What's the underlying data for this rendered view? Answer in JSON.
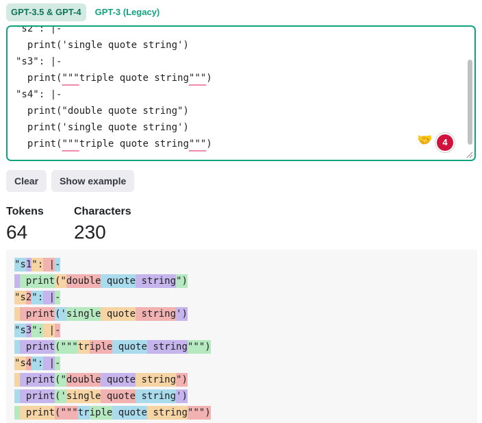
{
  "tabs": [
    {
      "label": "GPT-3.5 & GPT-4",
      "active": true
    },
    {
      "label": "GPT-3 (Legacy)",
      "active": false
    }
  ],
  "editor": {
    "lines": [
      [
        {
          "t": "\"s2\": |-",
          "sq": false
        }
      ],
      [
        {
          "t": "  print('single quote string')",
          "sq": false
        }
      ],
      [
        {
          "t": "\"s3\": |-",
          "sq": false
        }
      ],
      [
        {
          "t": "  print(",
          "sq": false
        },
        {
          "t": "\"\"\"",
          "sq": true
        },
        {
          "t": "triple quote string",
          "sq": false
        },
        {
          "t": "\"\"\"",
          "sq": true
        },
        {
          "t": ")",
          "sq": false
        }
      ],
      [
        {
          "t": "\"s4\": |-",
          "sq": false
        }
      ],
      [
        {
          "t": "  print(\"double quote string\")",
          "sq": false
        }
      ],
      [
        {
          "t": "  print('single quote string')",
          "sq": false
        }
      ],
      [
        {
          "t": "  print(",
          "sq": false
        },
        {
          "t": "\"\"\"",
          "sq": true
        },
        {
          "t": "triple quote string",
          "sq": false
        },
        {
          "t": "\"\"\"",
          "sq": true
        },
        {
          "t": ")",
          "sq": false
        }
      ]
    ],
    "handshake_emoji": "🤝",
    "badge_count": "4",
    "badge_color": "#d1123d",
    "border_color": "#10a37f"
  },
  "buttons": {
    "clear_label": "Clear",
    "example_label": "Show example"
  },
  "stats": {
    "tokens_label": "Tokens",
    "tokens_value": "64",
    "chars_label": "Characters",
    "chars_value": "230"
  },
  "token_colors": [
    "#c5b5ec",
    "#b7e9c1",
    "#f6d4a4",
    "#f2b2b2",
    "#a9dbec"
  ],
  "tokenized": [
    [
      [
        "\"s",
        4
      ],
      [
        "1",
        0
      ],
      [
        "\":",
        2
      ],
      [
        " |",
        3
      ],
      [
        "-",
        4
      ]
    ],
    [
      [
        " ",
        0
      ],
      [
        " print",
        1
      ],
      [
        "(\"",
        2
      ],
      [
        "double",
        3
      ],
      [
        " quote",
        4
      ],
      [
        " string",
        0
      ],
      [
        "\")",
        1
      ]
    ],
    [
      [
        "\"s",
        2
      ],
      [
        "2",
        3
      ],
      [
        "\":",
        4
      ],
      [
        " |",
        0
      ],
      [
        "-",
        1
      ]
    ],
    [
      [
        " ",
        2
      ],
      [
        " print",
        3
      ],
      [
        "('",
        4
      ],
      [
        "single",
        1
      ],
      [
        " quote",
        2
      ],
      [
        " string",
        3
      ],
      [
        "')",
        0
      ]
    ],
    [
      [
        "\"s",
        4
      ],
      [
        "3",
        0
      ],
      [
        "\":",
        1
      ],
      [
        " |",
        2
      ],
      [
        "-",
        3
      ]
    ],
    [
      [
        " ",
        4
      ],
      [
        " print",
        0
      ],
      [
        "(\"\"\"",
        1
      ],
      [
        "tr",
        2
      ],
      [
        "iple",
        3
      ],
      [
        " quote",
        4
      ],
      [
        " string",
        0
      ],
      [
        "\"\"\")",
        1
      ]
    ],
    [
      [
        "\"s",
        2
      ],
      [
        "4",
        3
      ],
      [
        "\":",
        4
      ],
      [
        " |",
        0
      ],
      [
        "-",
        1
      ]
    ],
    [
      [
        " ",
        2
      ],
      [
        " print",
        0
      ],
      [
        "(\"",
        1
      ],
      [
        "double",
        3
      ],
      [
        " quote",
        0
      ],
      [
        " string",
        2
      ],
      [
        "\")",
        3
      ]
    ],
    [
      [
        " ",
        4
      ],
      [
        " print",
        0
      ],
      [
        "('",
        1
      ],
      [
        "single",
        2
      ],
      [
        " quote",
        3
      ],
      [
        " string",
        4
      ],
      [
        "')",
        0
      ]
    ],
    [
      [
        " ",
        1
      ],
      [
        " print",
        2
      ],
      [
        "(\"\"\"",
        3
      ],
      [
        "tr",
        4
      ],
      [
        "iple",
        1
      ],
      [
        " quote",
        4
      ],
      [
        " string",
        2
      ],
      [
        "\"\"\")",
        3
      ]
    ]
  ]
}
